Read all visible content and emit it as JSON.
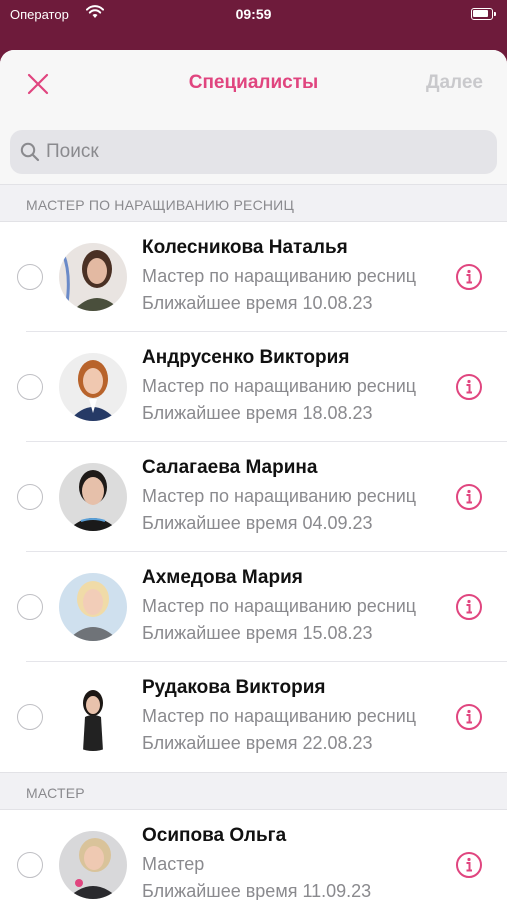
{
  "status_bar": {
    "carrier": "Оператор",
    "time": "09:59"
  },
  "nav": {
    "title": "Специалисты",
    "next_label": "Далее"
  },
  "search": {
    "placeholder": "Поиск"
  },
  "colors": {
    "accent": "#e0457f",
    "backdrop": "#6e1b3b"
  },
  "sections": [
    {
      "header": "МАСТЕР ПО НАРАЩИВАНИЮ РЕСНИЦ",
      "items": [
        {
          "name": "Колесникова Наталья",
          "role": "Мастер по наращиванию ресниц",
          "nearest": "Ближайшее время 10.08.23"
        },
        {
          "name": "Андрусенко Виктория",
          "role": "Мастер по наращиванию ресниц",
          "nearest": "Ближайшее время 18.08.23"
        },
        {
          "name": "Салагаева Марина",
          "role": "Мастер по наращиванию ресниц",
          "nearest": "Ближайшее время 04.09.23"
        },
        {
          "name": "Ахмедова Мария",
          "role": "Мастер по наращиванию ресниц",
          "nearest": "Ближайшее время 15.08.23"
        },
        {
          "name": "Рудакова Виктория",
          "role": "Мастер по наращиванию ресниц",
          "nearest": "Ближайшее время 22.08.23"
        }
      ]
    },
    {
      "header": "МАСТЕР",
      "items": [
        {
          "name": "Осипова Ольга",
          "role": "Мастер",
          "nearest": "Ближайшее время 11.09.23"
        }
      ]
    }
  ]
}
